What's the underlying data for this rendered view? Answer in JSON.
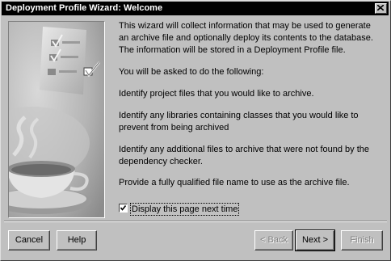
{
  "window": {
    "title": "Deployment Profile Wizard: Welcome"
  },
  "content": {
    "paragraphs": [
      "This wizard will collect information that may be used to generate an archive file and optionally deploy its contents to the database.  The information will be stored in a Deployment Profile file.",
      "You will be asked to do the following:",
      "Identify project files that you would like to archive.",
      "Identify any libraries containing classes that you would like to prevent from being archived",
      "Identify any additional files to archive that were not found by the dependency checker.",
      "Provide a fully qualified file name to use as the archive file."
    ]
  },
  "checkbox": {
    "label": "Display this page next time",
    "checked": true
  },
  "buttons": {
    "cancel": "Cancel",
    "help": "Help",
    "back": "< Back",
    "next": "Next >",
    "finish": "Finish"
  },
  "icons": [
    "close-icon",
    "checklist-illustration",
    "coffee-cup-illustration",
    "checkmark-icon"
  ]
}
